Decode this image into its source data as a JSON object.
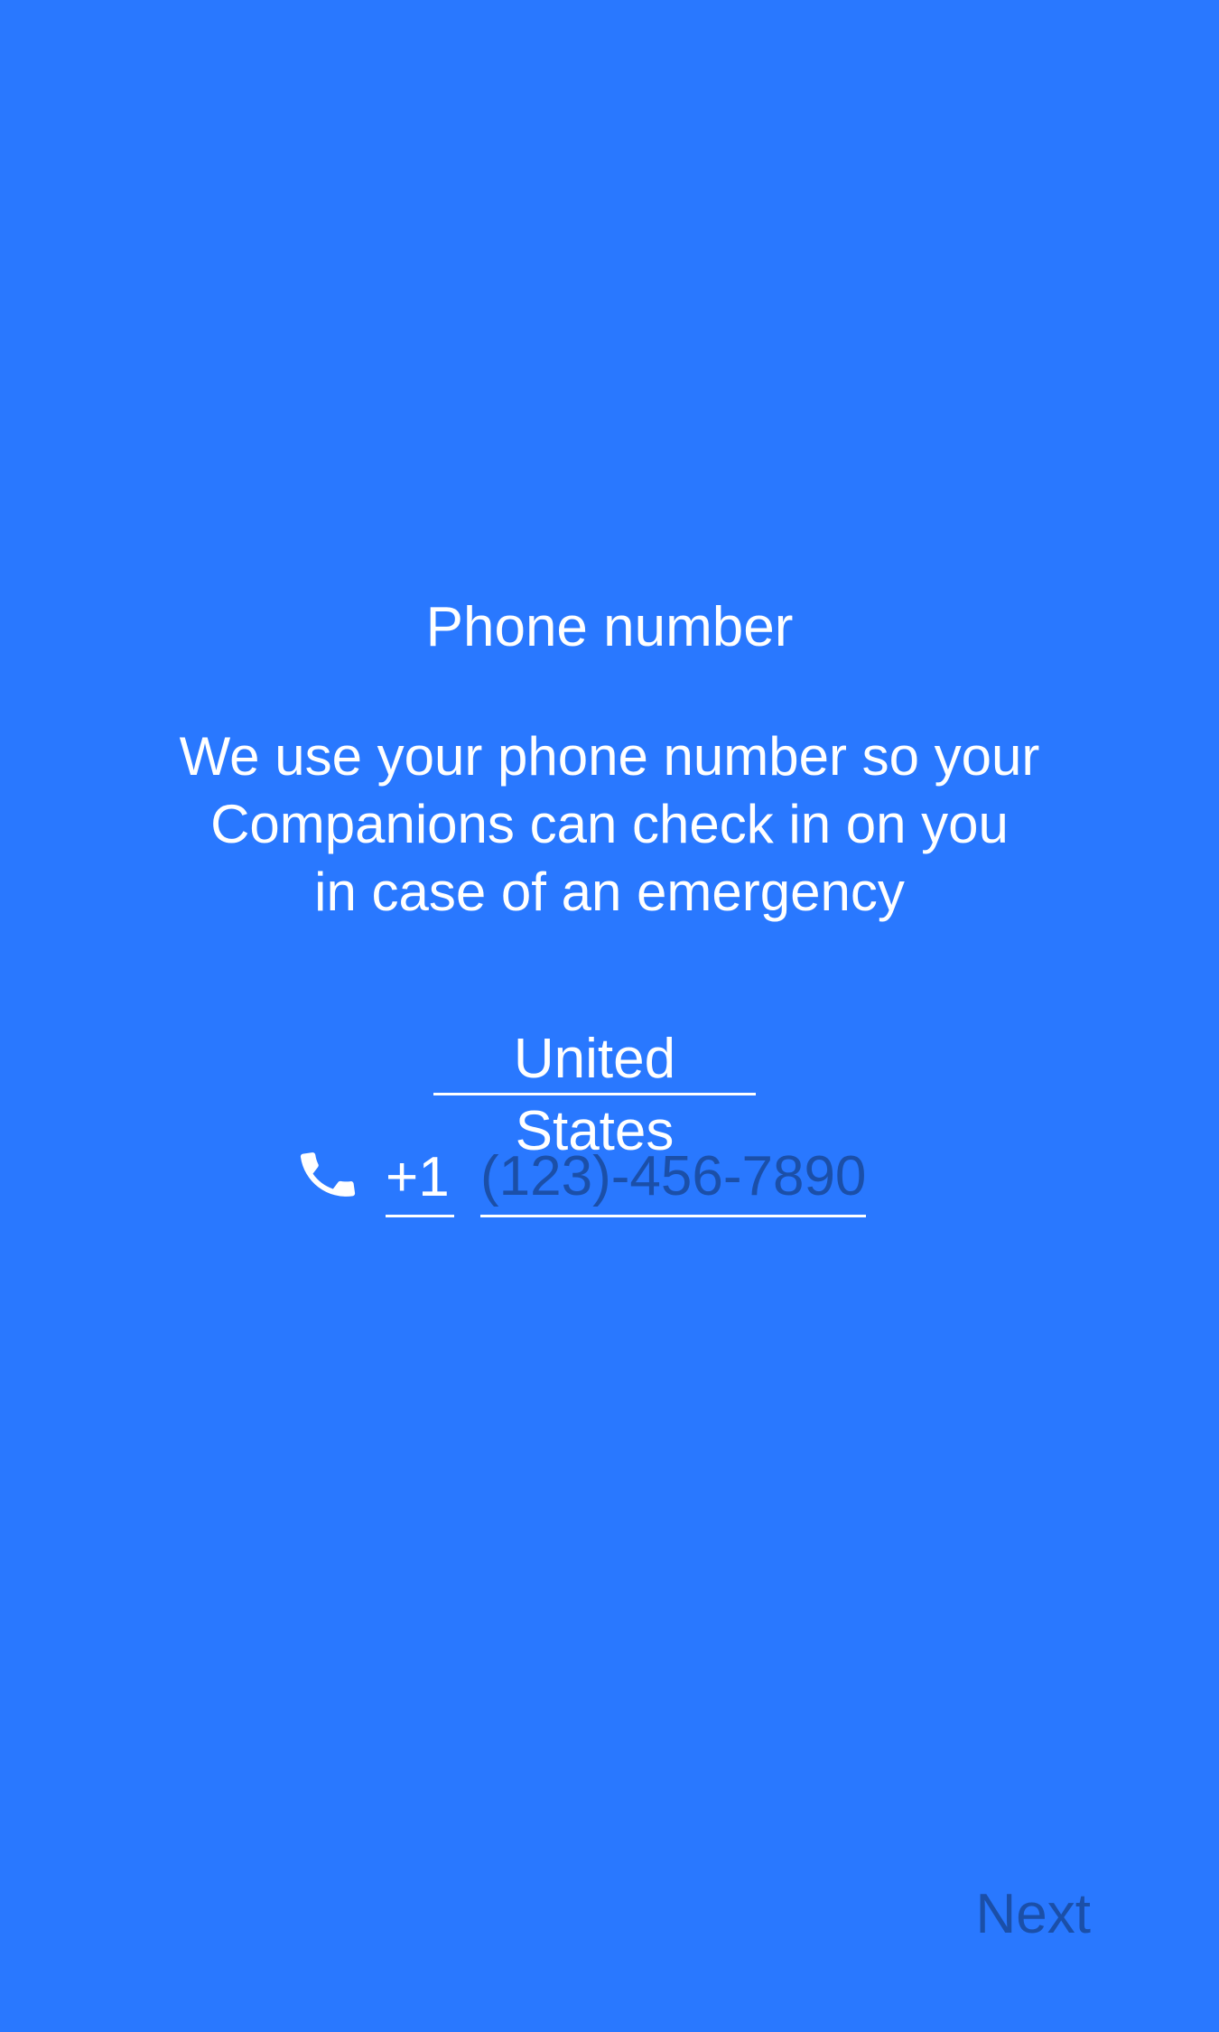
{
  "app": {
    "background_color": "#2978FF",
    "text_color": "#FFFFFF",
    "muted_text_color": "#1B4FA8"
  },
  "header": {
    "title": "Phone number"
  },
  "description": {
    "lines": [
      "We use your phone number so your",
      "Companions can check in on you",
      "in case of an emergency"
    ]
  },
  "country": {
    "selected": "United States"
  },
  "phone": {
    "icon": "phone-icon",
    "country_code": "+1",
    "value": "",
    "placeholder": "(123)-456-7890"
  },
  "footer": {
    "next_label": "Next"
  }
}
